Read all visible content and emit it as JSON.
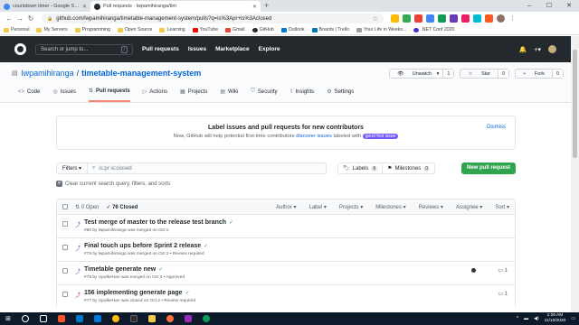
{
  "browser": {
    "tabs": [
      {
        "title": "countdown timer - Google Search",
        "favicon_color": "#4285f4"
      },
      {
        "title": "Pull requests · lwpamihiranga/tim",
        "favicon_color": "#24292e"
      }
    ],
    "url": "github.com/lwpamihiranga/timetable-management-system/pulls?q=is%3Apr+is%3Aclosed",
    "bookmarks": [
      "Personal",
      "My Servers",
      "Programming",
      "Open Source",
      "Learning",
      "YouTube",
      "Gmail",
      "GitHub",
      "Outlook",
      "Boards | Trello",
      "Your Life in Weeks...",
      ".NET Conf 2020"
    ]
  },
  "github": {
    "search_placeholder": "Search or jump to...",
    "search_key": "/",
    "nav": [
      "Pull requests",
      "Issues",
      "Marketplace",
      "Explore"
    ]
  },
  "repo": {
    "owner": "lwpamihiranga",
    "separator": "/",
    "name": "timetable-management-system",
    "unwatch_label": "Unwatch",
    "unwatch_count": "1",
    "star_label": "Star",
    "star_count": "0",
    "fork_label": "Fork",
    "fork_count": "0",
    "tabs": [
      "Code",
      "Issues",
      "Pull requests",
      "Actions",
      "Projects",
      "Wiki",
      "Security",
      "Insights",
      "Settings"
    ]
  },
  "banner": {
    "title": "Label issues and pull requests for new contributors",
    "text_before": "Now, GitHub will help potential first-time contributors ",
    "link": "discover issues",
    "text_after": " labeled with ",
    "label": "good first issue",
    "dismiss": "Dismiss"
  },
  "filter": {
    "filters_label": "Filters",
    "query": "is:pr is:closed",
    "labels_label": "Labels",
    "labels_count": "9",
    "milestones_label": "Milestones",
    "milestones_count": "0",
    "new_pr": "New pull request",
    "clear": "Clear current search query, filters, and sorts"
  },
  "list": {
    "open": "0 Open",
    "closed": "76 Closed",
    "sorts": [
      "Author ▾",
      "Label ▾",
      "Projects ▾",
      "Milestones ▾",
      "Reviews ▾",
      "Assignee ▾",
      "Sort ▾"
    ],
    "rows": [
      {
        "title": "Test merge of master to the release test branch",
        "meta": "#80 by lwpamihiranga was merged on Oct 2",
        "comments": ""
      },
      {
        "title": "Final touch ups before Sprint 2 release",
        "meta": "#79 by lwpamihiranga was merged on Oct 2 • Review required",
        "comments": ""
      },
      {
        "title": "Timetable generate new",
        "meta": "#78 by UpulkeHan was merged on Oct 2 • Approved",
        "comments": "1"
      },
      {
        "title": "156 implementing generate page",
        "meta": "#77 by UpulkeHan was closed on Oct 2 • Review required",
        "comments": "1"
      }
    ]
  },
  "taskbar": {
    "time": "1:26 AM",
    "date": "11/10/2020"
  }
}
